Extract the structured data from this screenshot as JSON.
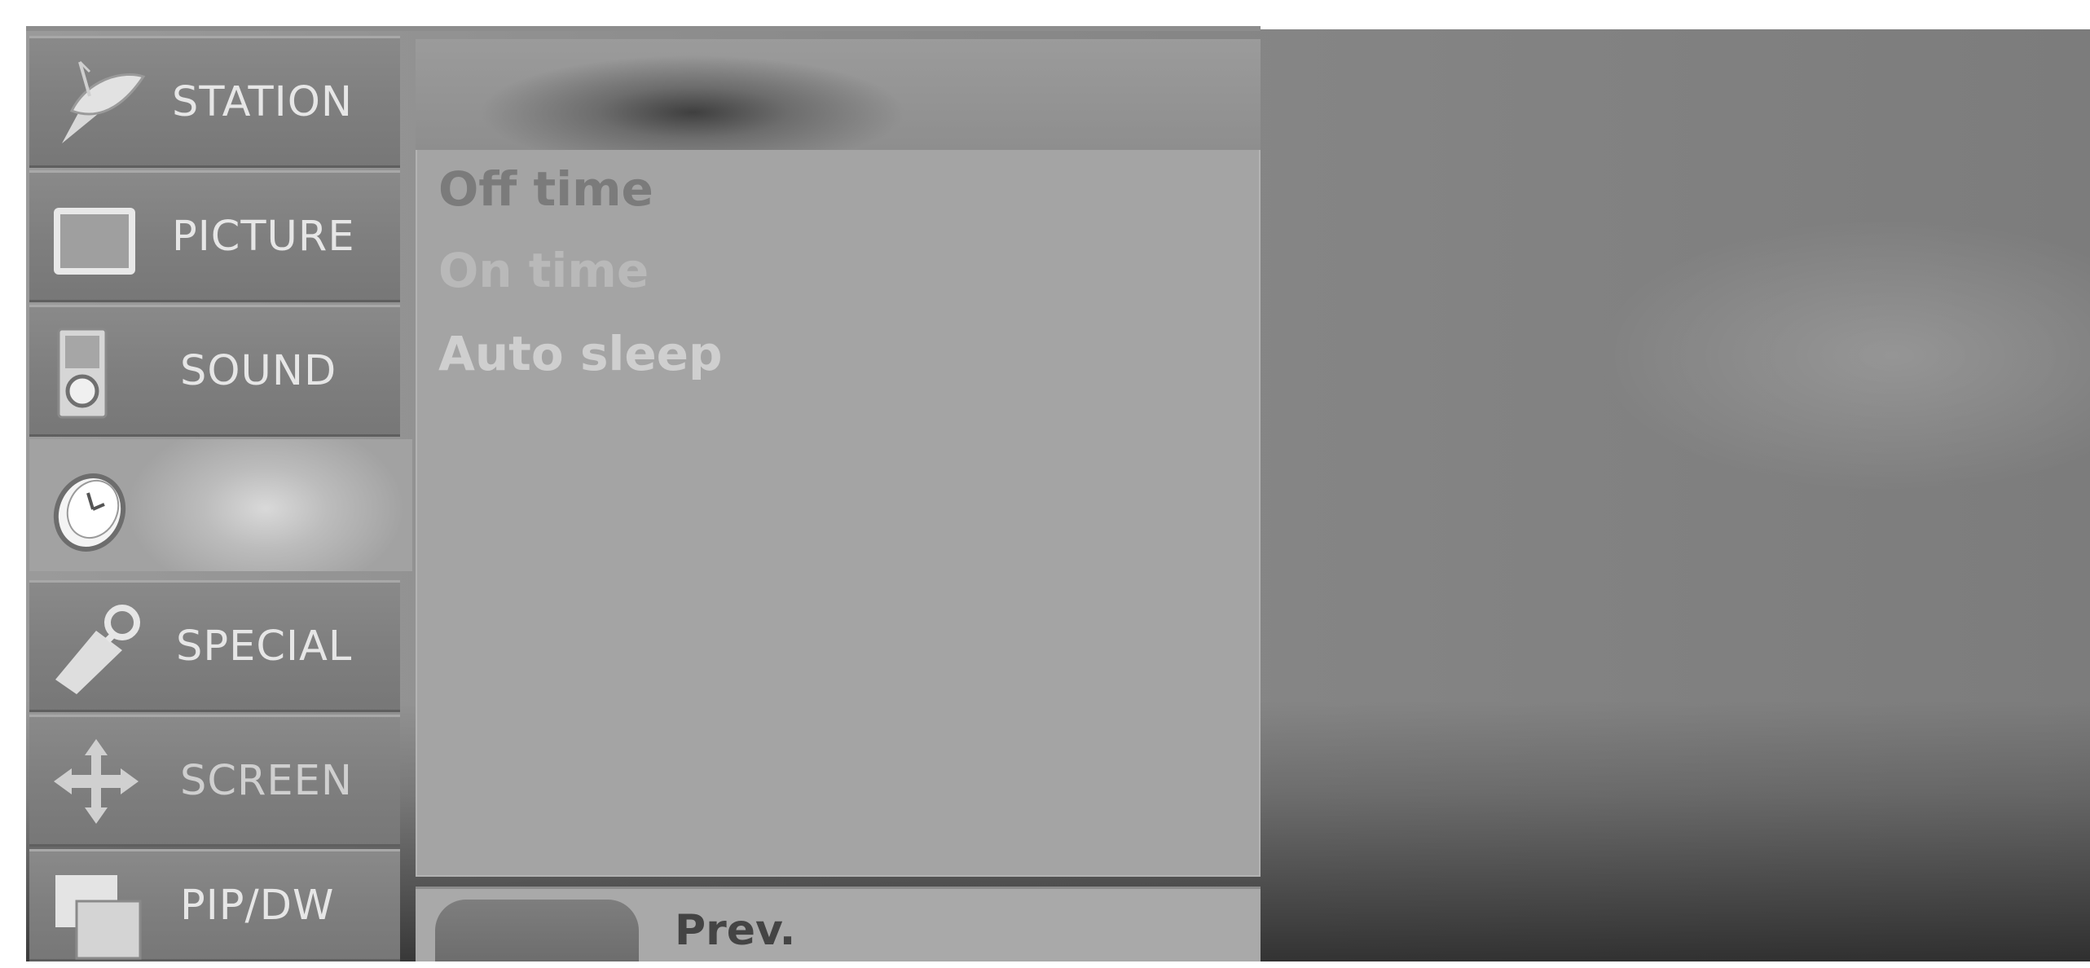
{
  "side_menu": {
    "items": [
      {
        "label": "STATION",
        "icon": "satellite-dish-icon"
      },
      {
        "label": "PICTURE",
        "icon": "picture-screen-icon"
      },
      {
        "label": "SOUND",
        "icon": "speaker-icon"
      },
      {
        "label": "",
        "icon": "clock-icon",
        "selected": true
      },
      {
        "label": "SPECIAL",
        "icon": "tag-icon"
      },
      {
        "label": "SCREEN",
        "icon": "move-arrows-icon"
      },
      {
        "label": "PIP/DW",
        "icon": "pip-windows-icon"
      }
    ]
  },
  "submenu": {
    "items": [
      {
        "label": "Off time"
      },
      {
        "label": "On time"
      },
      {
        "label": "Auto sleep"
      }
    ]
  },
  "hint_bar": {
    "prev_label": "Prev."
  }
}
